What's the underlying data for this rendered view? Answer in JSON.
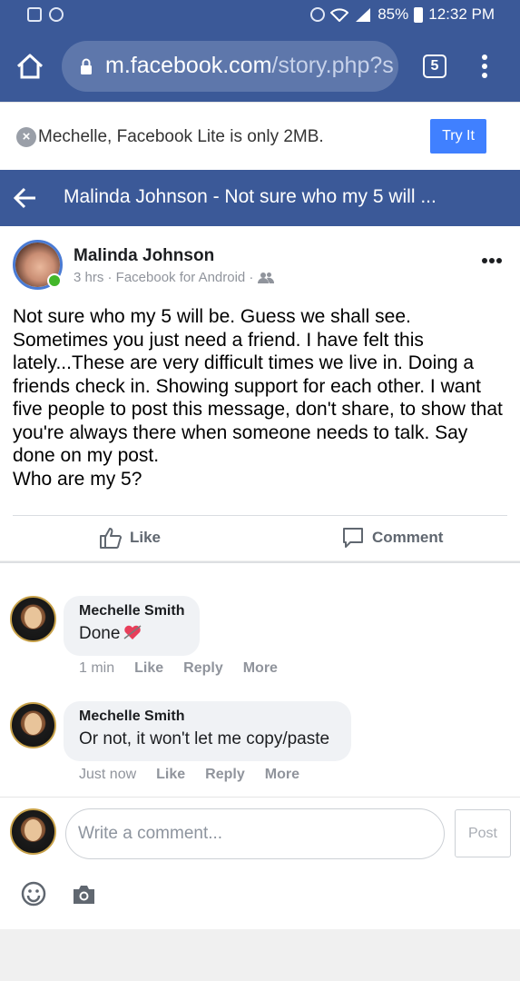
{
  "status_bar": {
    "battery": "85%",
    "time": "12:32 PM"
  },
  "browser": {
    "url_host": "m.facebook.com",
    "url_path": "/story.php?s",
    "tab_count": "5"
  },
  "promo": {
    "text": "Mechelle, Facebook Lite is only 2MB.",
    "button": "Try It"
  },
  "header": {
    "title": "Malinda Johnson - Not sure who my 5 will ..."
  },
  "post": {
    "author": "Malinda Johnson",
    "meta": "3 hrs · Facebook for Android ·",
    "body": "Not sure who my 5 will be. Guess we shall see.\nSometimes you just need a friend. I have felt this lately...These are very difficult times we live in. Doing a friends check in. Showing support for each other. I want five people to post this message, don't share, to show that you're always there when someone needs to talk. Say done on my post.\nWho are my 5?",
    "like_label": "Like",
    "comment_label": "Comment"
  },
  "comments": [
    {
      "author": "Mechelle Smith",
      "text": "Done",
      "time": "1 min",
      "like": "Like",
      "reply": "Reply",
      "more": "More"
    },
    {
      "author": "Mechelle Smith",
      "text": "Or not, it won't let me copy/paste",
      "time": "Just now",
      "like": "Like",
      "reply": "Reply",
      "more": "More"
    }
  ],
  "composer": {
    "placeholder": "Write a comment...",
    "post_button": "Post"
  },
  "colors": {
    "brand_blue": "#3b5998",
    "button_blue": "#4080ff",
    "online_green": "#42b72a"
  }
}
